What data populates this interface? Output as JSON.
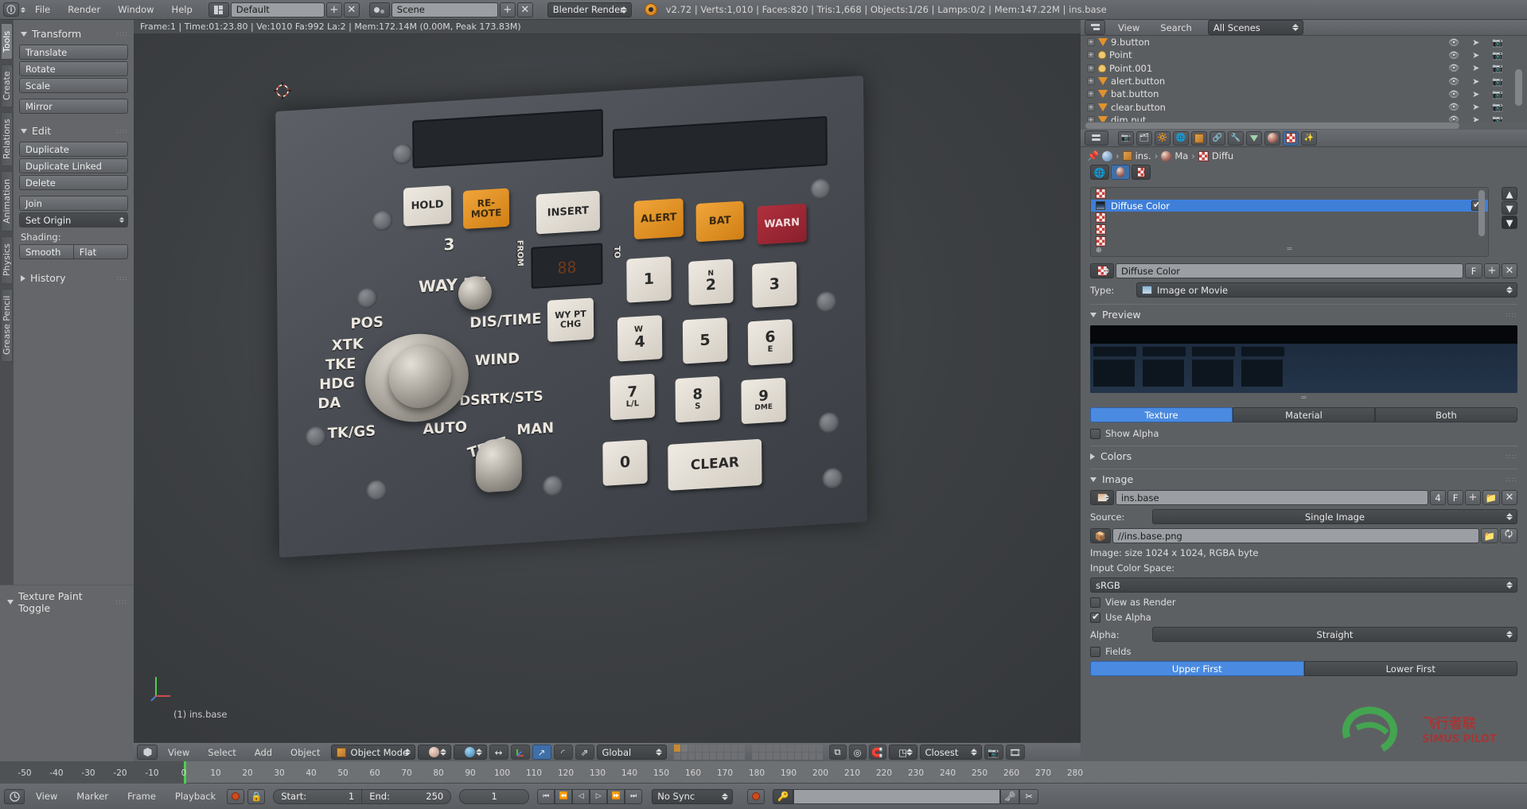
{
  "topbar": {
    "logo_icon": "blender-logo-icon",
    "menus": [
      "File",
      "Render",
      "Window",
      "Help"
    ],
    "layout_icon": "screen-layout-icon",
    "screen_value": "Default",
    "scene_icon": "scene-icon",
    "scene_value": "Scene",
    "add_label": "+",
    "remove_label": "✕",
    "engine_value": "Blender Render",
    "status_icon": "blender-status-icon",
    "stats": "v2.72 | Verts:1,010 | Faces:820 | Tris:1,668 | Objects:1/26 | Lamps:0/2 | Mem:147.22M | ins.base"
  },
  "toolshelf": {
    "tabs": [
      "Tools",
      "Create",
      "Relations",
      "Animation",
      "Physics",
      "Grease Pencil"
    ],
    "active_tab": "Tools",
    "sections": [
      {
        "title": "Transform",
        "buttons": [
          "Translate",
          "Rotate",
          "Scale",
          "Mirror"
        ]
      },
      {
        "title": "Edit",
        "buttons": [
          "Duplicate",
          "Duplicate Linked",
          "Delete",
          "Join",
          "Set Origin"
        ],
        "shading_label": "Shading:",
        "shading_options": [
          "Smooth",
          "Flat"
        ]
      }
    ],
    "history_label": "History"
  },
  "operator_panel": {
    "title": "Texture Paint Toggle"
  },
  "viewport": {
    "header_info": "Frame:1 | Time:01:23.80 | Ve:1010 Fa:992 La:2 | Mem:172.14M (0.00M, Peak 173.83M)",
    "object_label": "(1) ins.base",
    "footer": {
      "editor_icon": "3d-view-editor-icon",
      "menus": [
        "View",
        "Select",
        "Add",
        "Object"
      ],
      "mode_icon": "object-mode-icon",
      "mode_value": "Object Mode",
      "shading_icon": "solid-shading-icon",
      "pivot_icon": "pivot-median-icon",
      "manipulator_icons": [
        "translate-manipulator-icon",
        "rotate-manipulator-icon",
        "scale-manipulator-icon"
      ],
      "orientation_value": "Global",
      "layer_grid_icon": "scene-layers-icon",
      "lock_icon": "lock-object-modes-icon",
      "proportional_icon": "proportional-editing-icon",
      "snap_icon": "snap-magnet-icon",
      "snap_element_icon": "snap-element-vertex-icon",
      "snap_target_value": "Closest",
      "render_icon": "render-opengl-icon",
      "viewport_render_icon": "viewport-render-icon"
    },
    "panel_art": {
      "lcd_left": "",
      "lcd_right": "",
      "buttons": [
        {
          "label": "HOLD",
          "style": "white"
        },
        {
          "label": "RE-\nMOTE",
          "style": "orange"
        },
        {
          "label": "INSERT",
          "style": "white"
        },
        {
          "label": "ALERT",
          "style": "orange"
        },
        {
          "label": "BAT",
          "style": "orange"
        },
        {
          "label": "WARN",
          "style": "red"
        }
      ],
      "keypad": [
        [
          "1",
          "2",
          "3"
        ],
        [
          "4",
          "5",
          "6"
        ],
        [
          "7",
          "8",
          "9"
        ],
        [
          "0",
          "CLEAR"
        ]
      ],
      "keypad_sub": [
        [
          "",
          "N",
          ""
        ],
        [
          "W",
          "",
          "E"
        ],
        [
          "L/L",
          "S",
          "DME"
        ]
      ],
      "dial_labels": [
        "WAY PT",
        "DIS/TIME",
        "POS",
        "XTK",
        "TKE",
        "HDG",
        "DA",
        "WIND",
        "DSRTK/STS",
        "TK/GS",
        "AUTO",
        "MAN",
        "TEST"
      ],
      "small_labels": [
        "3",
        "FROM",
        "TO",
        "WY PT CHG"
      ],
      "display_value": "88"
    }
  },
  "outliner": {
    "editor_icon": "outliner-editor-icon",
    "menus": [
      "View",
      "Search"
    ],
    "scope_value": "All Scenes",
    "rows": [
      {
        "name": "9.button",
        "type": "mesh"
      },
      {
        "name": "Point",
        "type": "lamp"
      },
      {
        "name": "Point.001",
        "type": "lamp"
      },
      {
        "name": "alert.button",
        "type": "mesh"
      },
      {
        "name": "bat.button",
        "type": "mesh"
      },
      {
        "name": "clear.button",
        "type": "mesh"
      },
      {
        "name": "dim.nut",
        "type": "mesh"
      }
    ],
    "row_icons": [
      "eye-icon",
      "cursor-arrow-icon",
      "camera-icon"
    ]
  },
  "properties": {
    "tab_icons": [
      "render-tab-icon",
      "render-layers-tab-icon",
      "scene-tab-icon",
      "world-tab-icon",
      "object-tab-icon",
      "constraints-tab-icon",
      "modifiers-tab-icon",
      "data-tab-icon",
      "material-tab-icon",
      "texture-tab-icon",
      "particles-tab-icon"
    ],
    "active_tab": "texture-tab-icon",
    "breadcrumb": [
      "ins.",
      "Ma",
      "Diffu"
    ],
    "pin_icon": "pin-icon",
    "context_icons": [
      "world-texture-icon",
      "material-texture-icon",
      "brush-texture-icon"
    ],
    "texture_slots": [
      {
        "name": "",
        "selected": false,
        "enabled": false
      },
      {
        "name": "Diffuse Color",
        "selected": true,
        "enabled": true
      },
      {
        "name": "",
        "selected": false,
        "enabled": false
      },
      {
        "name": "",
        "selected": false,
        "enabled": false
      },
      {
        "name": "",
        "selected": false,
        "enabled": false
      }
    ],
    "datablock": {
      "icon": "texture-datablock-icon",
      "name": "Diffuse Color",
      "fake_user": "F",
      "new_label": "+",
      "unlink_label": "✕"
    },
    "type_label": "Type:",
    "type_value": "Image or Movie",
    "preview": {
      "title": "Preview",
      "modes": [
        "Texture",
        "Material",
        "Both"
      ],
      "active_mode": "Texture",
      "show_alpha_label": "Show Alpha",
      "show_alpha_checked": false
    },
    "colors_section": "Colors",
    "image_section": "Image",
    "image": {
      "icon": "image-datablock-icon",
      "name": "ins.base",
      "users": "4",
      "fake_user": "F",
      "new_label": "+",
      "open_label": "open-file-icon",
      "unlink_label": "✕",
      "source_label": "Source:",
      "source_value": "Single Image",
      "path_icon": "file-path-icon",
      "path_value": "//ins.base.png",
      "browse_icon": "browse-folder-icon",
      "reload_icon": "reload-icon",
      "info": "Image: size 1024 x 1024, RGBA byte",
      "colorspace_label": "Input Color Space:",
      "colorspace_value": "sRGB",
      "view_as_render_label": "View as Render",
      "view_as_render_checked": false,
      "use_alpha_label": "Use Alpha",
      "use_alpha_checked": true,
      "alpha_label": "Alpha:",
      "alpha_value": "Straight",
      "fields_label": "Fields",
      "fields_checked": false,
      "field_order": [
        "Upper First",
        "Lower First"
      ],
      "field_order_active": "Upper First"
    }
  },
  "timeline": {
    "editor_icon": "timeline-editor-icon",
    "menus": [
      "View",
      "Marker",
      "Frame",
      "Playback"
    ],
    "auto_key_icon": "record-auto-key-icon",
    "lock_icon": "lock-icon",
    "start_label": "Start:",
    "start_value": "1",
    "end_label": "End:",
    "end_value": "250",
    "current_frame": "1",
    "nav_icons": [
      "jump-start-icon",
      "prev-keyframe-icon",
      "play-reverse-icon",
      "play-icon",
      "next-keyframe-icon",
      "jump-end-icon"
    ],
    "sync_value": "No Sync",
    "record_icon": "record-icon",
    "keying_set_icon": "keying-set-icon",
    "keying_set_value": "",
    "add_keyframe_icon": "add-keyframe-icon",
    "delete_keyframe_icon": "delete-keyframe-icon",
    "ticks": [
      -50,
      -40,
      -30,
      -20,
      -10,
      0,
      10,
      20,
      30,
      40,
      50,
      60,
      70,
      80,
      90,
      100,
      110,
      120,
      130,
      140,
      150,
      160,
      170,
      180,
      190,
      200,
      210,
      220,
      230,
      240,
      250,
      260,
      270,
      280
    ],
    "playhead_frame": 0
  },
  "colors": {
    "accent_blue": "#4a8ae0",
    "select_blue": "#3f7fd8",
    "panel_bg": "#5d6063",
    "header_bg": "#6a6d71",
    "viewport_bg": "#3c3f42",
    "playhead_green": "#4bd04b",
    "orange_icon": "#e2922c",
    "record_red": "#d24a1e"
  },
  "watermark": {
    "text_cn": "飞行者联",
    "text_en": "SIMUS PILOT"
  }
}
